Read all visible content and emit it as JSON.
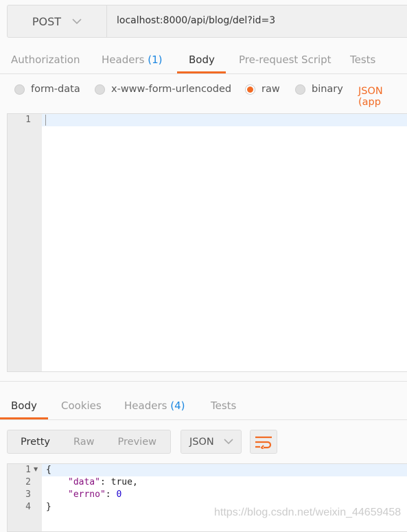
{
  "request": {
    "method": "POST",
    "url": "localhost:8000/api/blog/del?id=3",
    "tabs": [
      {
        "label": "Authorization"
      },
      {
        "label": "Headers",
        "count": "(1)"
      },
      {
        "label": "Body"
      },
      {
        "label": "Pre-request Script"
      },
      {
        "label": "Tests"
      }
    ],
    "active_tab": "Body",
    "body_types": [
      {
        "label": "form-data",
        "selected": false
      },
      {
        "label": "x-www-form-urlencoded",
        "selected": false
      },
      {
        "label": "raw",
        "selected": true
      },
      {
        "label": "binary",
        "selected": false
      }
    ],
    "content_type": "JSON (app",
    "editor_lines": [
      "1"
    ]
  },
  "response": {
    "tabs": [
      {
        "label": "Body"
      },
      {
        "label": "Cookies"
      },
      {
        "label": "Headers",
        "count": "(4)"
      },
      {
        "label": "Tests"
      }
    ],
    "active_tab": "Body",
    "view_modes": [
      "Pretty",
      "Raw",
      "Preview"
    ],
    "format": "JSON",
    "line_numbers": [
      "1",
      "2",
      "3",
      "4"
    ],
    "code": {
      "open": "{",
      "k1": "\"data\"",
      "v1": "true",
      "k2": "\"errno\"",
      "v2": "0",
      "close": "}"
    }
  },
  "colors": {
    "accent": "#f26b24",
    "count": "#1a86e0"
  },
  "watermark": "https://blog.csdn.net/weixin_44659458"
}
